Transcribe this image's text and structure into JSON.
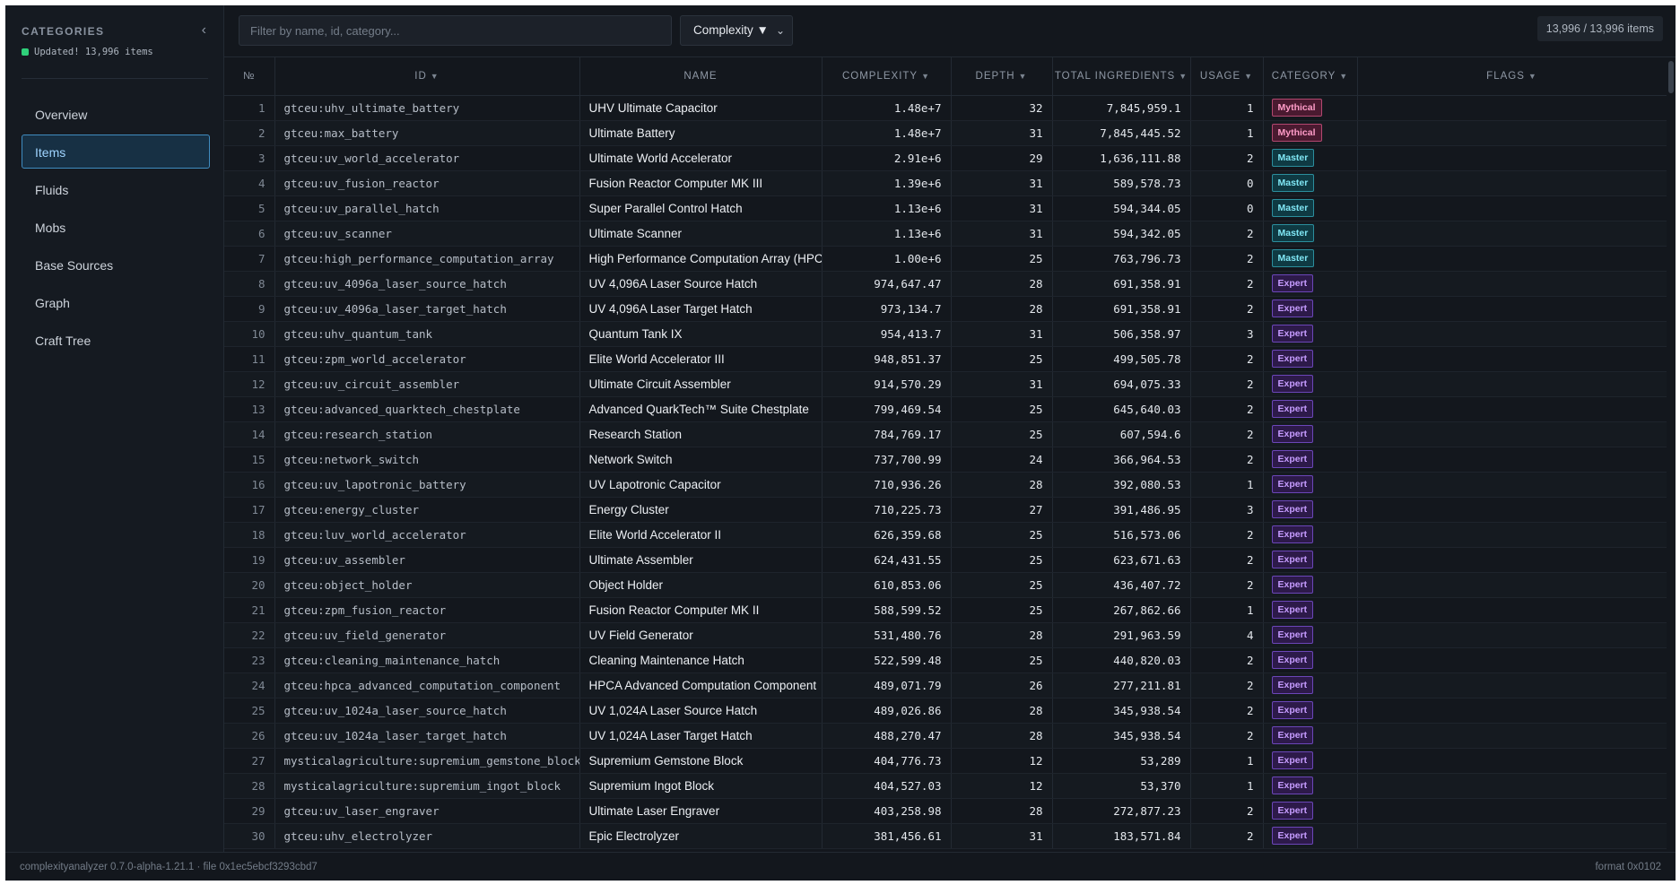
{
  "sidebar": {
    "title": "CATEGORIES",
    "status": "Updated! 13,996 items",
    "items": [
      {
        "label": "Overview"
      },
      {
        "label": "Items",
        "active": true
      },
      {
        "label": "Fluids"
      },
      {
        "label": "Mobs"
      },
      {
        "label": "Base Sources"
      },
      {
        "label": "Graph"
      },
      {
        "label": "Craft Tree"
      }
    ]
  },
  "toolbar": {
    "filter_placeholder": "Filter by name, id, category...",
    "sort_label": "Complexity ▼",
    "count": "13,996 / 13,996 items"
  },
  "table": {
    "columns": [
      {
        "key": "no",
        "label": "№",
        "sortable": false
      },
      {
        "key": "id",
        "label": "ID",
        "sortable": true
      },
      {
        "key": "name",
        "label": "NAME",
        "sortable": false
      },
      {
        "key": "complexity",
        "label": "COMPLEXITY",
        "sortable": true
      },
      {
        "key": "depth",
        "label": "DEPTH",
        "sortable": true
      },
      {
        "key": "total",
        "label": "TOTAL INGREDIENTS",
        "sortable": true
      },
      {
        "key": "usage",
        "label": "USAGE",
        "sortable": true
      },
      {
        "key": "category",
        "label": "CATEGORY",
        "sortable": true
      },
      {
        "key": "flags",
        "label": "FLAGS",
        "sortable": true
      }
    ],
    "rows": [
      {
        "no": "1",
        "id": "gtceu:uhv_ultimate_battery",
        "name": "UHV Ultimate Capacitor",
        "complexity": "1.48e+7",
        "depth": "32",
        "total": "7,845,959.1",
        "usage": "1",
        "category": "Mythical"
      },
      {
        "no": "2",
        "id": "gtceu:max_battery",
        "name": "Ultimate Battery",
        "complexity": "1.48e+7",
        "depth": "31",
        "total": "7,845,445.52",
        "usage": "1",
        "category": "Mythical"
      },
      {
        "no": "3",
        "id": "gtceu:uv_world_accelerator",
        "name": "Ultimate World Accelerator",
        "complexity": "2.91e+6",
        "depth": "29",
        "total": "1,636,111.88",
        "usage": "2",
        "category": "Master"
      },
      {
        "no": "4",
        "id": "gtceu:uv_fusion_reactor",
        "name": "Fusion Reactor Computer MK III",
        "complexity": "1.39e+6",
        "depth": "31",
        "total": "589,578.73",
        "usage": "0",
        "category": "Master"
      },
      {
        "no": "5",
        "id": "gtceu:uv_parallel_hatch",
        "name": "Super Parallel Control Hatch",
        "complexity": "1.13e+6",
        "depth": "31",
        "total": "594,344.05",
        "usage": "0",
        "category": "Master"
      },
      {
        "no": "6",
        "id": "gtceu:uv_scanner",
        "name": "Ultimate Scanner",
        "complexity": "1.13e+6",
        "depth": "31",
        "total": "594,342.05",
        "usage": "2",
        "category": "Master"
      },
      {
        "no": "7",
        "id": "gtceu:high_performance_computation_array",
        "name": "High Performance Computation Array (HPCA)",
        "complexity": "1.00e+6",
        "depth": "25",
        "total": "763,796.73",
        "usage": "2",
        "category": "Master"
      },
      {
        "no": "8",
        "id": "gtceu:uv_4096a_laser_source_hatch",
        "name": "UV 4,096A Laser Source Hatch",
        "complexity": "974,647.47",
        "depth": "28",
        "total": "691,358.91",
        "usage": "2",
        "category": "Expert"
      },
      {
        "no": "9",
        "id": "gtceu:uv_4096a_laser_target_hatch",
        "name": "UV 4,096A Laser Target Hatch",
        "complexity": "973,134.7",
        "depth": "28",
        "total": "691,358.91",
        "usage": "2",
        "category": "Expert"
      },
      {
        "no": "10",
        "id": "gtceu:uhv_quantum_tank",
        "name": "Quantum Tank IX",
        "complexity": "954,413.7",
        "depth": "31",
        "total": "506,358.97",
        "usage": "3",
        "category": "Expert"
      },
      {
        "no": "11",
        "id": "gtceu:zpm_world_accelerator",
        "name": "Elite World Accelerator III",
        "complexity": "948,851.37",
        "depth": "25",
        "total": "499,505.78",
        "usage": "2",
        "category": "Expert"
      },
      {
        "no": "12",
        "id": "gtceu:uv_circuit_assembler",
        "name": "Ultimate Circuit Assembler",
        "complexity": "914,570.29",
        "depth": "31",
        "total": "694,075.33",
        "usage": "2",
        "category": "Expert"
      },
      {
        "no": "13",
        "id": "gtceu:advanced_quarktech_chestplate",
        "name": "Advanced QuarkTech™ Suite Chestplate",
        "complexity": "799,469.54",
        "depth": "25",
        "total": "645,640.03",
        "usage": "2",
        "category": "Expert"
      },
      {
        "no": "14",
        "id": "gtceu:research_station",
        "name": "Research Station",
        "complexity": "784,769.17",
        "depth": "25",
        "total": "607,594.6",
        "usage": "2",
        "category": "Expert"
      },
      {
        "no": "15",
        "id": "gtceu:network_switch",
        "name": "Network Switch",
        "complexity": "737,700.99",
        "depth": "24",
        "total": "366,964.53",
        "usage": "2",
        "category": "Expert"
      },
      {
        "no": "16",
        "id": "gtceu:uv_lapotronic_battery",
        "name": "UV Lapotronic Capacitor",
        "complexity": "710,936.26",
        "depth": "28",
        "total": "392,080.53",
        "usage": "1",
        "category": "Expert"
      },
      {
        "no": "17",
        "id": "gtceu:energy_cluster",
        "name": "Energy Cluster",
        "complexity": "710,225.73",
        "depth": "27",
        "total": "391,486.95",
        "usage": "3",
        "category": "Expert"
      },
      {
        "no": "18",
        "id": "gtceu:luv_world_accelerator",
        "name": "Elite World Accelerator II",
        "complexity": "626,359.68",
        "depth": "25",
        "total": "516,573.06",
        "usage": "2",
        "category": "Expert"
      },
      {
        "no": "19",
        "id": "gtceu:uv_assembler",
        "name": "Ultimate Assembler",
        "complexity": "624,431.55",
        "depth": "25",
        "total": "623,671.63",
        "usage": "2",
        "category": "Expert"
      },
      {
        "no": "20",
        "id": "gtceu:object_holder",
        "name": "Object Holder",
        "complexity": "610,853.06",
        "depth": "25",
        "total": "436,407.72",
        "usage": "2",
        "category": "Expert"
      },
      {
        "no": "21",
        "id": "gtceu:zpm_fusion_reactor",
        "name": "Fusion Reactor Computer MK II",
        "complexity": "588,599.52",
        "depth": "25",
        "total": "267,862.66",
        "usage": "1",
        "category": "Expert"
      },
      {
        "no": "22",
        "id": "gtceu:uv_field_generator",
        "name": "UV Field Generator",
        "complexity": "531,480.76",
        "depth": "28",
        "total": "291,963.59",
        "usage": "4",
        "category": "Expert"
      },
      {
        "no": "23",
        "id": "gtceu:cleaning_maintenance_hatch",
        "name": "Cleaning Maintenance Hatch",
        "complexity": "522,599.48",
        "depth": "25",
        "total": "440,820.03",
        "usage": "2",
        "category": "Expert"
      },
      {
        "no": "24",
        "id": "gtceu:hpca_advanced_computation_component",
        "name": "HPCA Advanced Computation Component",
        "complexity": "489,071.79",
        "depth": "26",
        "total": "277,211.81",
        "usage": "2",
        "category": "Expert"
      },
      {
        "no": "25",
        "id": "gtceu:uv_1024a_laser_source_hatch",
        "name": "UV 1,024A Laser Source Hatch",
        "complexity": "489,026.86",
        "depth": "28",
        "total": "345,938.54",
        "usage": "2",
        "category": "Expert"
      },
      {
        "no": "26",
        "id": "gtceu:uv_1024a_laser_target_hatch",
        "name": "UV 1,024A Laser Target Hatch",
        "complexity": "488,270.47",
        "depth": "28",
        "total": "345,938.54",
        "usage": "2",
        "category": "Expert"
      },
      {
        "no": "27",
        "id": "mysticalagriculture:supremium_gemstone_block",
        "name": "Supremium Gemstone Block",
        "complexity": "404,776.73",
        "depth": "12",
        "total": "53,289",
        "usage": "1",
        "category": "Expert"
      },
      {
        "no": "28",
        "id": "mysticalagriculture:supremium_ingot_block",
        "name": "Supremium Ingot Block",
        "complexity": "404,527.03",
        "depth": "12",
        "total": "53,370",
        "usage": "1",
        "category": "Expert"
      },
      {
        "no": "29",
        "id": "gtceu:uv_laser_engraver",
        "name": "Ultimate Laser Engraver",
        "complexity": "403,258.98",
        "depth": "28",
        "total": "272,877.23",
        "usage": "2",
        "category": "Expert"
      },
      {
        "no": "30",
        "id": "gtceu:uhv_electrolyzer",
        "name": "Epic Electrolyzer",
        "complexity": "381,456.61",
        "depth": "31",
        "total": "183,571.84",
        "usage": "2",
        "category": "Expert"
      }
    ]
  },
  "footer": {
    "left": "complexityanalyzer 0.7.0-alpha-1.21.1 · file 0x1ec5ebcf3293cbd7",
    "right": "format 0x0102"
  },
  "colors": {
    "background": "#13171d",
    "accent": "#3f8cc0",
    "mythical": "#ff9cc8",
    "master": "#7fe6f4",
    "expert": "#c69cff",
    "status_ok": "#2fd07a"
  }
}
